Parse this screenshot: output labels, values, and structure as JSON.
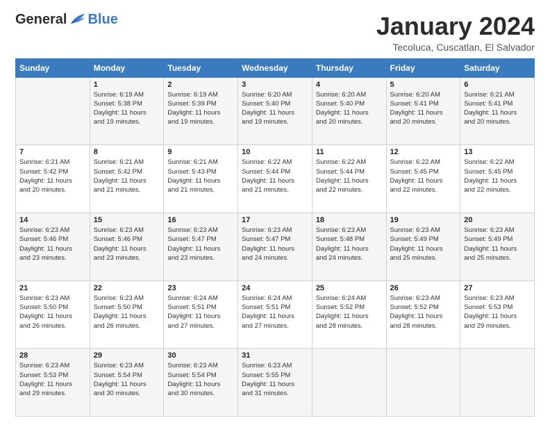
{
  "header": {
    "logo_general": "General",
    "logo_blue": "Blue",
    "month_title": "January 2024",
    "subtitle": "Tecoluca, Cuscatlan, El Salvador"
  },
  "weekdays": [
    "Sunday",
    "Monday",
    "Tuesday",
    "Wednesday",
    "Thursday",
    "Friday",
    "Saturday"
  ],
  "weeks": [
    [
      {
        "day": "",
        "info": ""
      },
      {
        "day": "1",
        "info": "Sunrise: 6:19 AM\nSunset: 5:38 PM\nDaylight: 11 hours\nand 19 minutes."
      },
      {
        "day": "2",
        "info": "Sunrise: 6:19 AM\nSunset: 5:39 PM\nDaylight: 11 hours\nand 19 minutes."
      },
      {
        "day": "3",
        "info": "Sunrise: 6:20 AM\nSunset: 5:40 PM\nDaylight: 11 hours\nand 19 minutes."
      },
      {
        "day": "4",
        "info": "Sunrise: 6:20 AM\nSunset: 5:40 PM\nDaylight: 11 hours\nand 20 minutes."
      },
      {
        "day": "5",
        "info": "Sunrise: 6:20 AM\nSunset: 5:41 PM\nDaylight: 11 hours\nand 20 minutes."
      },
      {
        "day": "6",
        "info": "Sunrise: 6:21 AM\nSunset: 5:41 PM\nDaylight: 11 hours\nand 20 minutes."
      }
    ],
    [
      {
        "day": "7",
        "info": "Sunrise: 6:21 AM\nSunset: 5:42 PM\nDaylight: 11 hours\nand 20 minutes."
      },
      {
        "day": "8",
        "info": "Sunrise: 6:21 AM\nSunset: 5:42 PM\nDaylight: 11 hours\nand 21 minutes."
      },
      {
        "day": "9",
        "info": "Sunrise: 6:21 AM\nSunset: 5:43 PM\nDaylight: 11 hours\nand 21 minutes."
      },
      {
        "day": "10",
        "info": "Sunrise: 6:22 AM\nSunset: 5:44 PM\nDaylight: 11 hours\nand 21 minutes."
      },
      {
        "day": "11",
        "info": "Sunrise: 6:22 AM\nSunset: 5:44 PM\nDaylight: 11 hours\nand 22 minutes."
      },
      {
        "day": "12",
        "info": "Sunrise: 6:22 AM\nSunset: 5:45 PM\nDaylight: 11 hours\nand 22 minutes."
      },
      {
        "day": "13",
        "info": "Sunrise: 6:22 AM\nSunset: 5:45 PM\nDaylight: 11 hours\nand 22 minutes."
      }
    ],
    [
      {
        "day": "14",
        "info": "Sunrise: 6:23 AM\nSunset: 5:46 PM\nDaylight: 11 hours\nand 23 minutes."
      },
      {
        "day": "15",
        "info": "Sunrise: 6:23 AM\nSunset: 5:46 PM\nDaylight: 11 hours\nand 23 minutes."
      },
      {
        "day": "16",
        "info": "Sunrise: 6:23 AM\nSunset: 5:47 PM\nDaylight: 11 hours\nand 23 minutes."
      },
      {
        "day": "17",
        "info": "Sunrise: 6:23 AM\nSunset: 5:47 PM\nDaylight: 11 hours\nand 24 minutes."
      },
      {
        "day": "18",
        "info": "Sunrise: 6:23 AM\nSunset: 5:48 PM\nDaylight: 11 hours\nand 24 minutes."
      },
      {
        "day": "19",
        "info": "Sunrise: 6:23 AM\nSunset: 5:49 PM\nDaylight: 11 hours\nand 25 minutes."
      },
      {
        "day": "20",
        "info": "Sunrise: 6:23 AM\nSunset: 5:49 PM\nDaylight: 11 hours\nand 25 minutes."
      }
    ],
    [
      {
        "day": "21",
        "info": "Sunrise: 6:23 AM\nSunset: 5:50 PM\nDaylight: 11 hours\nand 26 minutes."
      },
      {
        "day": "22",
        "info": "Sunrise: 6:23 AM\nSunset: 5:50 PM\nDaylight: 11 hours\nand 26 minutes."
      },
      {
        "day": "23",
        "info": "Sunrise: 6:24 AM\nSunset: 5:51 PM\nDaylight: 11 hours\nand 27 minutes."
      },
      {
        "day": "24",
        "info": "Sunrise: 6:24 AM\nSunset: 5:51 PM\nDaylight: 11 hours\nand 27 minutes."
      },
      {
        "day": "25",
        "info": "Sunrise: 6:24 AM\nSunset: 5:52 PM\nDaylight: 11 hours\nand 28 minutes."
      },
      {
        "day": "26",
        "info": "Sunrise: 6:23 AM\nSunset: 5:52 PM\nDaylight: 11 hours\nand 28 minutes."
      },
      {
        "day": "27",
        "info": "Sunrise: 6:23 AM\nSunset: 5:53 PM\nDaylight: 11 hours\nand 29 minutes."
      }
    ],
    [
      {
        "day": "28",
        "info": "Sunrise: 6:23 AM\nSunset: 5:53 PM\nDaylight: 11 hours\nand 29 minutes."
      },
      {
        "day": "29",
        "info": "Sunrise: 6:23 AM\nSunset: 5:54 PM\nDaylight: 11 hours\nand 30 minutes."
      },
      {
        "day": "30",
        "info": "Sunrise: 6:23 AM\nSunset: 5:54 PM\nDaylight: 11 hours\nand 30 minutes."
      },
      {
        "day": "31",
        "info": "Sunrise: 6:23 AM\nSunset: 5:55 PM\nDaylight: 11 hours\nand 31 minutes."
      },
      {
        "day": "",
        "info": ""
      },
      {
        "day": "",
        "info": ""
      },
      {
        "day": "",
        "info": ""
      }
    ]
  ]
}
